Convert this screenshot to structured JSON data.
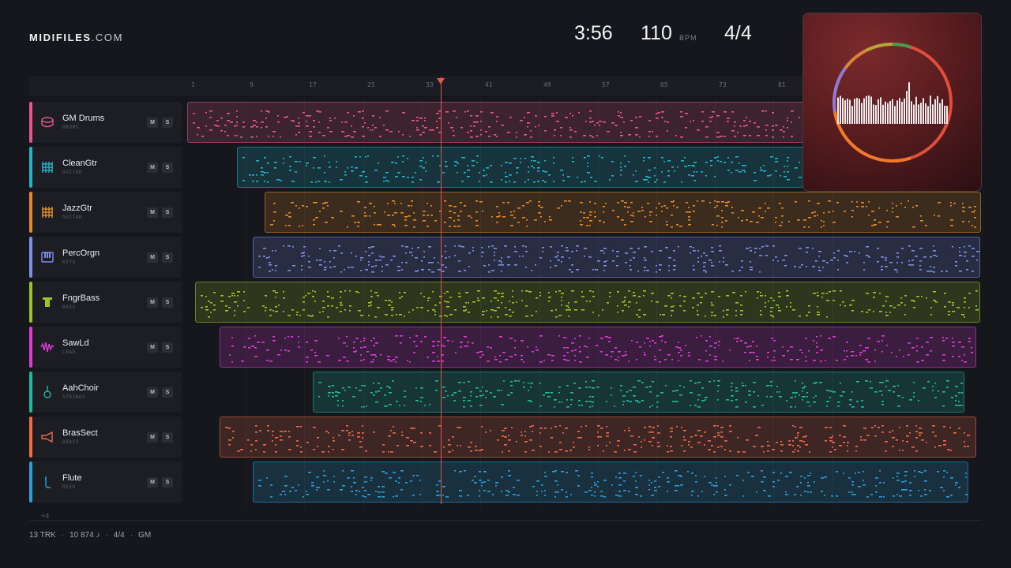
{
  "brand": {
    "name": "MIDIFILES",
    "domain": ".COM"
  },
  "transport": {
    "time": "3:56",
    "bpm": "110",
    "bpm_unit": "BPM",
    "signature": "4/4"
  },
  "ruler": {
    "ticks": [
      "1",
      "9",
      "17",
      "25",
      "33",
      "41",
      "49",
      "57",
      "65",
      "73",
      "81"
    ]
  },
  "tracks": [
    {
      "name": "GM Drums",
      "sub": "DRUMS",
      "color": "#e9568a",
      "icon": "drum-icon",
      "mute": "M",
      "solo": "S"
    },
    {
      "name": "CleanGtr",
      "sub": "GUITAR",
      "color": "#1fb5c9",
      "icon": "guitar-icon",
      "mute": "M",
      "solo": "S"
    },
    {
      "name": "JazzGtr",
      "sub": "GUITAR",
      "color": "#e58a24",
      "icon": "guitar-icon",
      "mute": "M",
      "solo": "S"
    },
    {
      "name": "PercOrgn",
      "sub": "KEYS",
      "color": "#7e8fe8",
      "icon": "keys-icon",
      "mute": "M",
      "solo": "S"
    },
    {
      "name": "FngrBass",
      "sub": "BASS",
      "color": "#9bc424",
      "icon": "bass-icon",
      "mute": "M",
      "solo": "S"
    },
    {
      "name": "SawLd",
      "sub": "LEAD",
      "color": "#de3bd8",
      "icon": "wave-icon",
      "mute": "M",
      "solo": "S"
    },
    {
      "name": "AahChoir",
      "sub": "STRINGS",
      "color": "#1fb8a0",
      "icon": "violin-icon",
      "mute": "M",
      "solo": "S"
    },
    {
      "name": "BrasSect",
      "sub": "BRASS",
      "color": "#ee6a48",
      "icon": "horn-icon",
      "mute": "M",
      "solo": "S"
    },
    {
      "name": "Flute",
      "sub": "REED",
      "color": "#2a9fdc",
      "icon": "flute-icon",
      "mute": "M",
      "solo": "S"
    }
  ],
  "more_tracks": "+4",
  "footer": {
    "tracks": "13 TRK",
    "notes": "10 874 ♪",
    "signature": "4/4",
    "standard": "GM"
  },
  "colors": {
    "background": "#15171c",
    "playhead": "#e2574c",
    "album_bg": "#5b1d20"
  }
}
